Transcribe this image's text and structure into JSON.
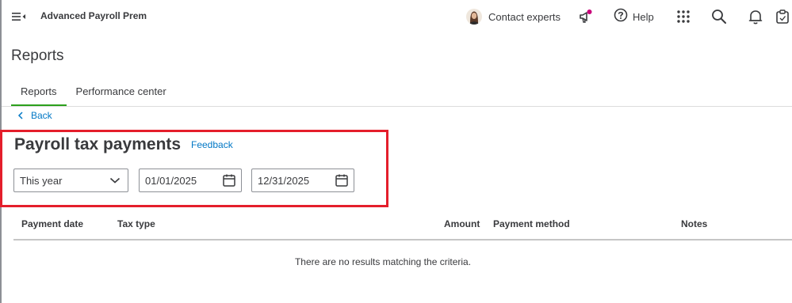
{
  "topbar": {
    "app_title": "Advanced Payroll Prem",
    "contact_label": "Contact experts",
    "help_label": "Help",
    "icons": [
      "menu-icon",
      "avatar",
      "announcement-icon",
      "help-icon",
      "apps-grid-icon",
      "search-icon",
      "bell-icon",
      "clipboard-icon"
    ],
    "notification_dot_color": "#c9007a"
  },
  "page": {
    "title": "Reports",
    "tabs": [
      {
        "label": "Reports",
        "active": true
      },
      {
        "label": "Performance center",
        "active": false
      }
    ],
    "back_label": "Back"
  },
  "report": {
    "title": "Payroll tax payments",
    "feedback_label": "Feedback",
    "period": "This year",
    "start_date": "01/01/2025",
    "end_date": "12/31/2025"
  },
  "table": {
    "columns": [
      "Payment date",
      "Tax type",
      "Amount",
      "Payment method",
      "Notes"
    ],
    "empty_message": "There are no results matching the criteria."
  },
  "colors": {
    "accent_green": "#2ca01c",
    "link_blue": "#0077c5",
    "highlight_red": "#e41e2b"
  }
}
